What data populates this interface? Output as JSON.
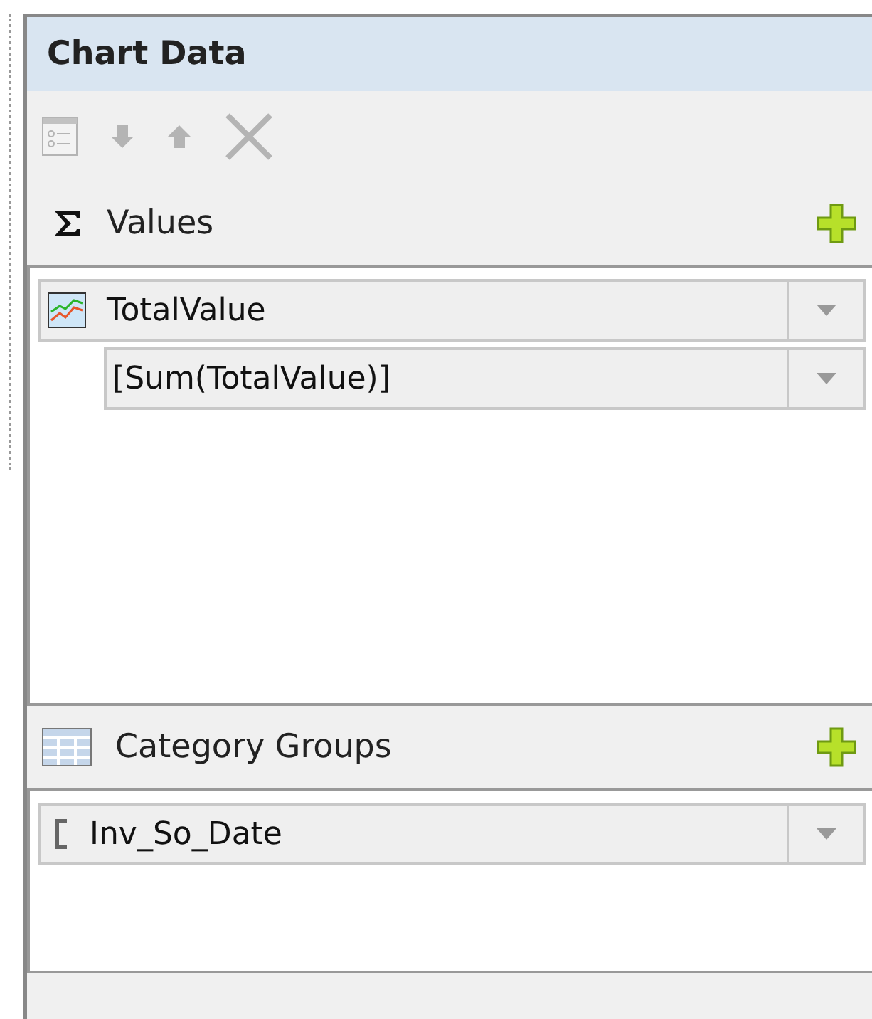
{
  "panel": {
    "title": "Chart Data"
  },
  "toolbar": [
    {
      "kind": "properties",
      "disabled": true
    },
    {
      "kind": "down",
      "disabled": true
    },
    {
      "kind": "up",
      "disabled": true
    },
    {
      "kind": "delete",
      "disabled": true
    }
  ],
  "sections": [
    {
      "kind": "values",
      "title": "Values",
      "items": [
        {
          "kind": "series",
          "label": "TotalValue",
          "children": [
            {
              "label": "[Sum(TotalValue)]"
            }
          ]
        }
      ]
    },
    {
      "kind": "categories",
      "title": "Category Groups",
      "items": [
        {
          "kind": "group",
          "label": "Inv_So_Date"
        }
      ]
    }
  ]
}
